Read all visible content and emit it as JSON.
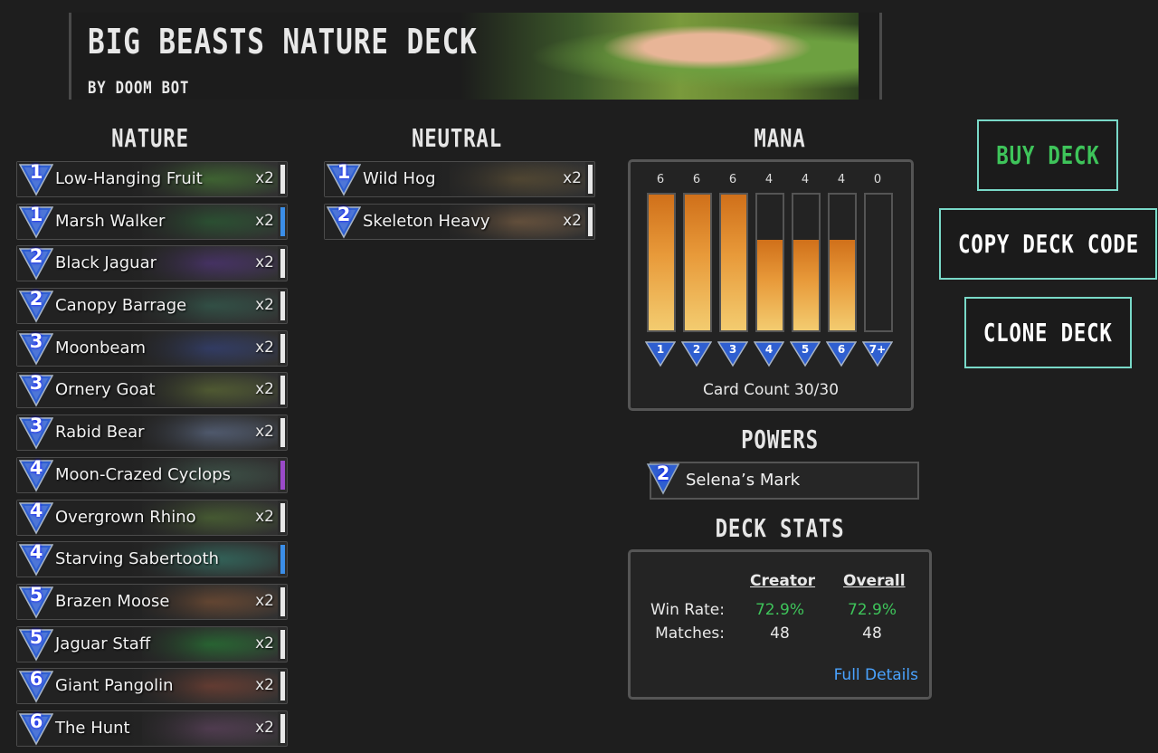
{
  "header": {
    "title": "BIG BEASTS NATURE DECK",
    "author": "BY DOOM BOT"
  },
  "sections": {
    "nature": "NATURE",
    "neutral": "NEUTRAL",
    "mana": "MANA",
    "powers": "POWERS",
    "deck_stats": "DECK STATS"
  },
  "nature_cards": [
    {
      "cost": "1",
      "name": "Low-Hanging Fruit",
      "qty": "x2",
      "rarity_color": "#e8e8e8",
      "art": "#4f8a3a"
    },
    {
      "cost": "1",
      "name": "Marsh Walker",
      "qty": "x2",
      "rarity_color": "#3b8ee8",
      "art": "#2f6a3a"
    },
    {
      "cost": "2",
      "name": "Black Jaguar",
      "qty": "x2",
      "rarity_color": "#e8e8e8",
      "art": "#5a3a8a"
    },
    {
      "cost": "2",
      "name": "Canopy Barrage",
      "qty": "x2",
      "rarity_color": "#e8e8e8",
      "art": "#3a6a5a"
    },
    {
      "cost": "3",
      "name": "Moonbeam",
      "qty": "x2",
      "rarity_color": "#e8e8e8",
      "art": "#3a4a8a"
    },
    {
      "cost": "3",
      "name": "Ornery Goat",
      "qty": "x2",
      "rarity_color": "#e8e8e8",
      "art": "#6a7a3a"
    },
    {
      "cost": "3",
      "name": "Rabid Bear",
      "qty": "x2",
      "rarity_color": "#e8e8e8",
      "art": "#6a7a9a"
    },
    {
      "cost": "4",
      "name": "Moon-Crazed Cyclops",
      "qty": "",
      "rarity_color": "#9a4ac8",
      "art": "#4a6a5a"
    },
    {
      "cost": "4",
      "name": "Overgrown Rhino",
      "qty": "x2",
      "rarity_color": "#e8e8e8",
      "art": "#5a7a3a"
    },
    {
      "cost": "4",
      "name": "Starving Sabertooth",
      "qty": "",
      "rarity_color": "#3b8ee8",
      "art": "#3a8a7a"
    },
    {
      "cost": "5",
      "name": "Brazen Moose",
      "qty": "x2",
      "rarity_color": "#e8e8e8",
      "art": "#8a5a3a"
    },
    {
      "cost": "5",
      "name": "Jaguar Staff",
      "qty": "x2",
      "rarity_color": "#e8e8e8",
      "art": "#2a8a3a"
    },
    {
      "cost": "6",
      "name": "Giant Pangolin",
      "qty": "x2",
      "rarity_color": "#e8e8e8",
      "art": "#8a4a3a"
    },
    {
      "cost": "6",
      "name": "The Hunt",
      "qty": "x2",
      "rarity_color": "#e8e8e8",
      "art": "#6a4a6a"
    }
  ],
  "neutral_cards": [
    {
      "cost": "1",
      "name": "Wild Hog",
      "qty": "x2",
      "rarity_color": "#e8e8e8",
      "art": "#6a5a3a"
    },
    {
      "cost": "2",
      "name": "Skeleton Heavy",
      "qty": "x2",
      "rarity_color": "#e8e8e8",
      "art": "#8a6a4a"
    }
  ],
  "mana_curve": [
    {
      "label": "1",
      "count": "6",
      "fill": 1.0
    },
    {
      "label": "2",
      "count": "6",
      "fill": 1.0
    },
    {
      "label": "3",
      "count": "6",
      "fill": 1.0
    },
    {
      "label": "4",
      "count": "4",
      "fill": 0.667
    },
    {
      "label": "5",
      "count": "4",
      "fill": 0.667
    },
    {
      "label": "6",
      "count": "4",
      "fill": 0.667
    },
    {
      "label": "7+",
      "count": "0",
      "fill": 0
    }
  ],
  "card_count": "Card Count 30/30",
  "power": {
    "cost": "2",
    "name": "Selena’s Mark"
  },
  "stats": {
    "col_creator": "Creator",
    "col_overall": "Overall",
    "win_rate_label": "Win Rate:",
    "matches_label": "Matches:",
    "creator_win_rate": "72.9%",
    "overall_win_rate": "72.9%",
    "creator_matches": "48",
    "overall_matches": "48",
    "full_details": "Full Details",
    "win_color": "#3ec45a"
  },
  "buttons": {
    "buy": "BUY DECK",
    "copy": "COPY DECK CODE",
    "clone": "CLONE DECK"
  },
  "colors": {
    "accent_border": "#79d9c8",
    "buy_text": "#3ec45a",
    "gem_blue": "#2f5fd0"
  }
}
